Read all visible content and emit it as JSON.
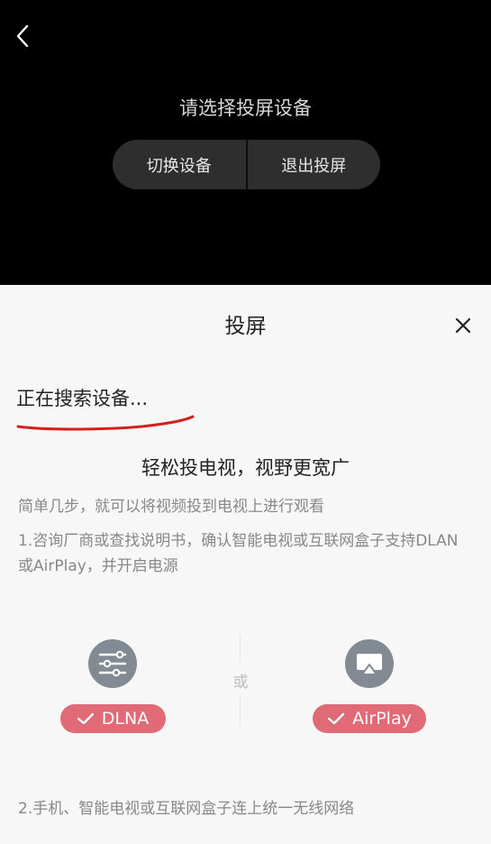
{
  "top": {
    "prompt": "请选择投屏设备",
    "switch_device": "切换设备",
    "exit_cast": "退出投屏"
  },
  "sheet": {
    "title": "投屏",
    "status": "正在搜索设备...",
    "headline": "轻松投电视，视野更宽广",
    "subline": "简单几步，就可以将视频投到电视上进行观看",
    "step1": "1.咨询厂商或查找说明书，确认智能电视或互联网盒子支持DLAN或AirPlay，并开启电源",
    "protocols": {
      "dlna_label": "DLNA",
      "or_label": "或",
      "airplay_label": "AirPlay"
    },
    "step2": "2.手机、智能电视或互联网盒子连上统一无线网络"
  },
  "icons": {
    "back": "chevron-left-icon",
    "close": "close-icon",
    "dlna": "dlna-icon",
    "airplay": "airplay-icon",
    "check": "check-icon"
  },
  "colors": {
    "badge": "#e06a75",
    "protocol_icon": "#838a94",
    "scribble": "#d62020"
  }
}
